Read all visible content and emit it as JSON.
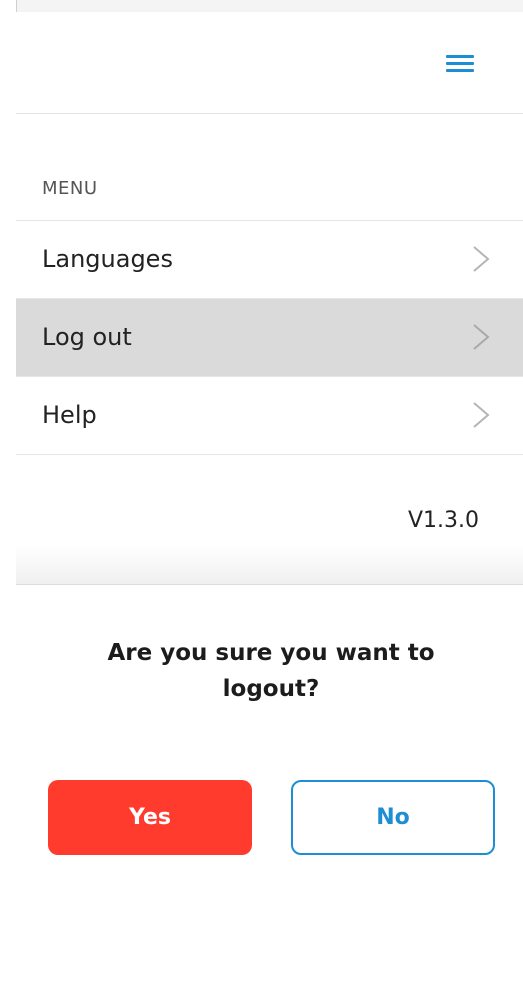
{
  "header": {
    "menu_icon": "hamburger-menu-icon",
    "accent_color": "#1e8ed4"
  },
  "menu": {
    "heading": "MENU",
    "items": [
      {
        "label": "Languages",
        "icon": "chevron-right-icon",
        "active": false
      },
      {
        "label": "Log out",
        "icon": "chevron-right-icon",
        "active": true
      },
      {
        "label": "Help",
        "icon": "chevron-right-icon",
        "active": false
      }
    ],
    "version": "V1.3.0"
  },
  "dialog": {
    "title": "Are you sure you want to logout?",
    "yes_label": "Yes",
    "no_label": "No",
    "yes_color": "#ff3b2e",
    "no_color": "#1e8ed4"
  }
}
